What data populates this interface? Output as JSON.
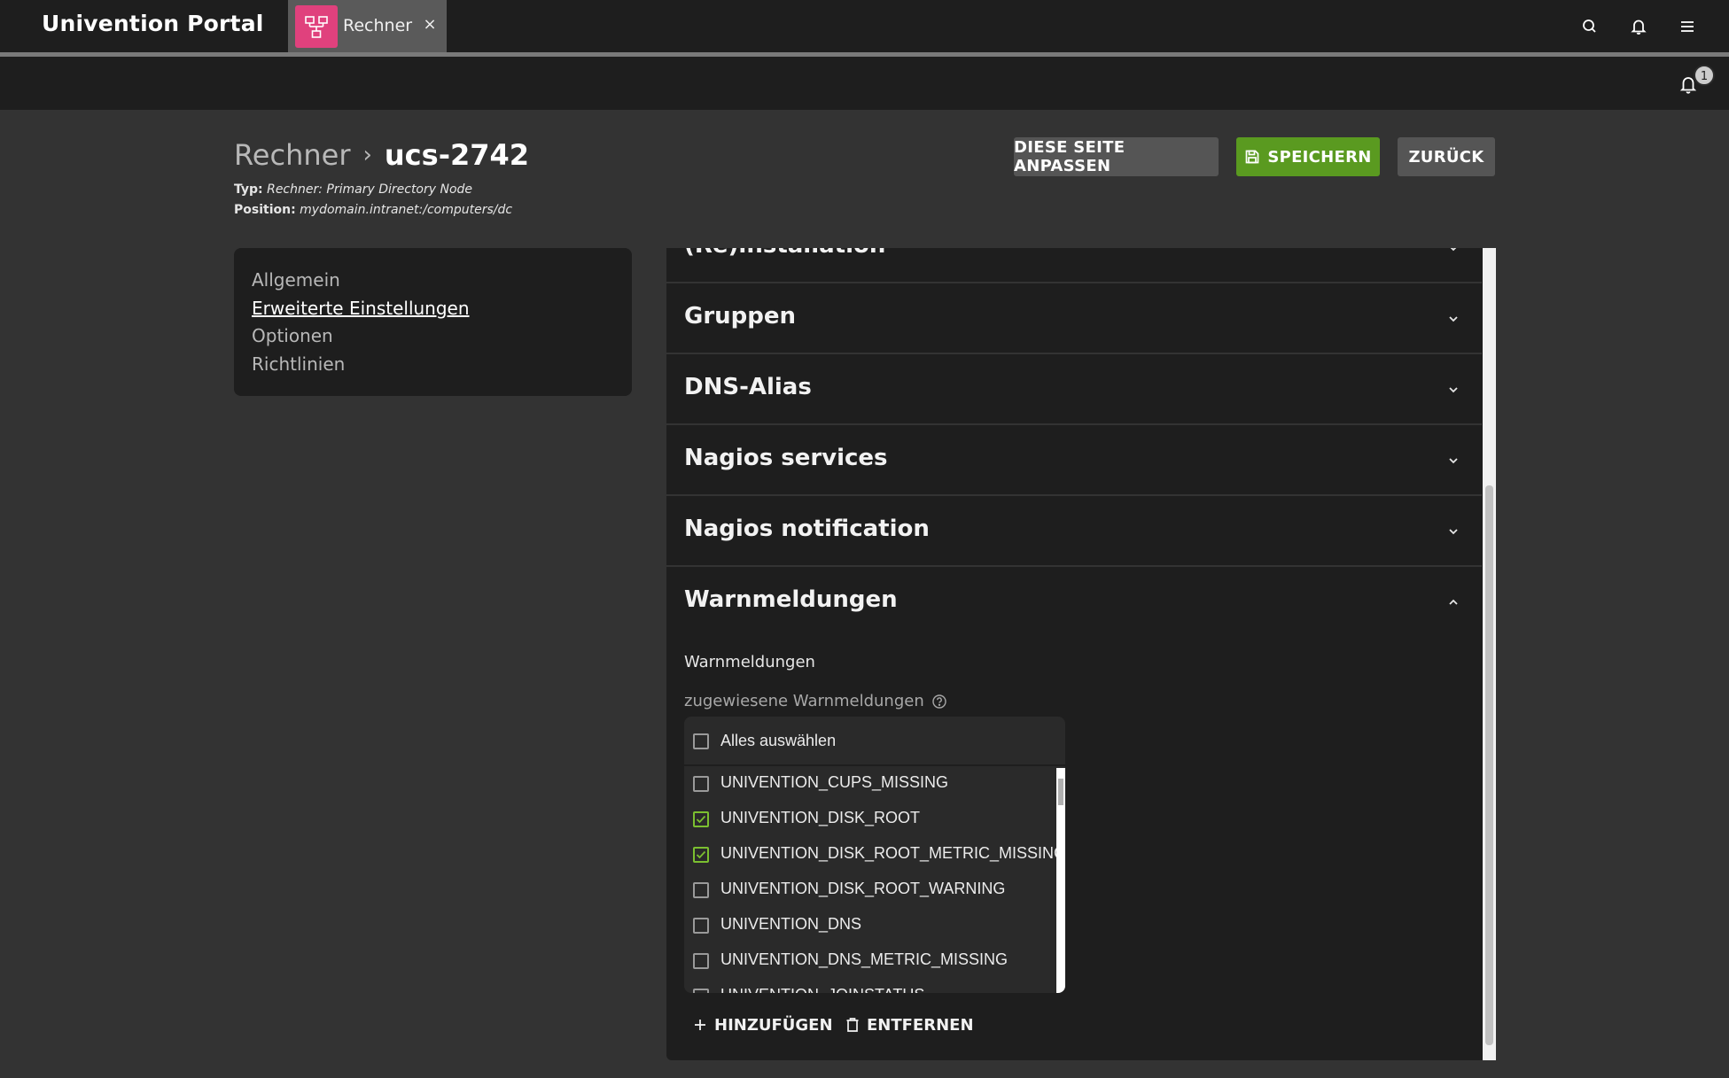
{
  "header": {
    "portal_title": "Univention Portal",
    "tab_label": "Rechner",
    "tab_close": "×",
    "search_icon": "search-icon",
    "bell_icon": "bell-icon",
    "menu_icon": "menu-icon"
  },
  "notifications": {
    "count": "1"
  },
  "page": {
    "breadcrumb_parent": "Rechner",
    "breadcrumb_separator": "›",
    "breadcrumb_current": "ucs-2742",
    "type_label": "Typ:",
    "type_value": "Rechner: Primary Directory Node",
    "position_label": "Position:",
    "position_value": "mydomain.intranet:/computers/dc"
  },
  "buttons": {
    "customize": "DIESE SEITE ANPASSEN",
    "save": "SPEICHERN",
    "back": "ZURÜCK"
  },
  "nav": {
    "items": [
      {
        "label": "Allgemein",
        "active": false
      },
      {
        "label": "Erweiterte Einstellungen",
        "active": true
      },
      {
        "label": "Optionen",
        "active": false
      },
      {
        "label": "Richtlinien",
        "active": false
      }
    ]
  },
  "sections": [
    {
      "title": "(Re)installation",
      "expanded": false
    },
    {
      "title": "Gruppen",
      "expanded": false
    },
    {
      "title": "DNS-Alias",
      "expanded": false
    },
    {
      "title": "Nagios services",
      "expanded": false
    },
    {
      "title": "Nagios notification",
      "expanded": false
    },
    {
      "title": "Warnmeldungen",
      "expanded": true
    }
  ],
  "warnings": {
    "field_label": "Warnmeldungen",
    "assigned_label": "zugewiesene Warnmeldungen",
    "select_all": "Alles auswählen",
    "items": [
      {
        "label": "UNIVENTION_CUPS_MISSING",
        "checked": false
      },
      {
        "label": "UNIVENTION_DISK_ROOT",
        "checked": true
      },
      {
        "label": "UNIVENTION_DISK_ROOT_METRIC_MISSING",
        "checked": true
      },
      {
        "label": "UNIVENTION_DISK_ROOT_WARNING",
        "checked": false
      },
      {
        "label": "UNIVENTION_DNS",
        "checked": false
      },
      {
        "label": "UNIVENTION_DNS_METRIC_MISSING",
        "checked": false
      },
      {
        "label": "UNIVENTION_JOINSTATUS",
        "checked": false
      }
    ],
    "add_label": "HINZUFÜGEN",
    "remove_label": "ENTFERNEN"
  },
  "colors": {
    "accent_green": "#5a9a20",
    "checkbox_green": "#7bbf30",
    "tab_icon_pink": "#e0417d"
  }
}
